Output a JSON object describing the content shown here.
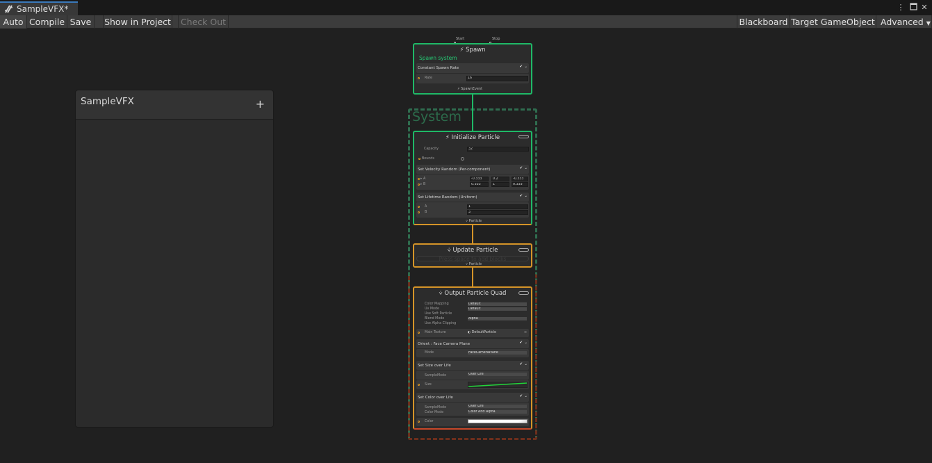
{
  "window": {
    "tab_title": "SampleVFX*",
    "controls": {
      "menu": "⋮",
      "maximize": "□",
      "close": "✕"
    }
  },
  "toolbar": {
    "auto": "Auto",
    "compile": "Compile",
    "save": "Save",
    "show_in_project": "Show in Project",
    "check_out": "Check Out",
    "blackboard": "Blackboard",
    "target_gameobject": "Target GameObject",
    "advanced": "Advanced"
  },
  "blackboard": {
    "title": "SampleVFX",
    "add_icon": "+"
  },
  "system": {
    "label": "System"
  },
  "spawn": {
    "title": "Spawn",
    "start": "Start",
    "stop": "Stop",
    "subtitle": "Spawn system",
    "block": "Constant Spawn Rate",
    "rate_label": "Rate",
    "rate_value": "16",
    "output": "SpawnEvent"
  },
  "initialize": {
    "title": "Initialize Particle",
    "capacity_label": "Capacity",
    "capacity_value": "32",
    "bounds_label": "Bounds",
    "velocity_block": "Set Velocity Random (Per-component)",
    "a_label": "A",
    "b_label": "B",
    "a_values": [
      "-0.333",
      "0.2",
      "-0.333"
    ],
    "b_values": [
      "0.333",
      "1",
      "0.333"
    ],
    "lifetime_block": "Set Lifetime Random (Uniform)",
    "life_a": "1",
    "life_b": "3",
    "output": "Particle"
  },
  "update": {
    "title": "Update Particle",
    "hint": "Press space to add blocks",
    "output": "Particle"
  },
  "output_ctx": {
    "title": "Output Particle Quad",
    "settings": [
      {
        "label": "Color Mapping",
        "value": "Default"
      },
      {
        "label": "Uv Mode",
        "value": "Default"
      },
      {
        "label": "Use Soft Particle",
        "value": ""
      },
      {
        "label": "Blend Mode",
        "value": "Alpha"
      },
      {
        "label": "Use Alpha Clipping",
        "value": ""
      }
    ],
    "main_texture_label": "Main Texture",
    "main_texture_value": "DefaultParticle",
    "orient_block": "Orient : Face Camera Plane",
    "mode_label": "Mode",
    "mode_value": "FaceCameraPlane",
    "size_block": "Set Size over Life",
    "sample_mode_label": "SampleMode",
    "sample_mode_value": "Over Life",
    "size_label": "Size",
    "color_block": "Set Color over Life",
    "color_sample_mode_value": "Over Life",
    "color_mode_label": "Color Mode",
    "color_mode_value": "Color And Alpha",
    "color_label": "Color"
  },
  "colors": {
    "spawn": "#1fb967",
    "particle": "#d59428",
    "output": "#c9482a"
  }
}
